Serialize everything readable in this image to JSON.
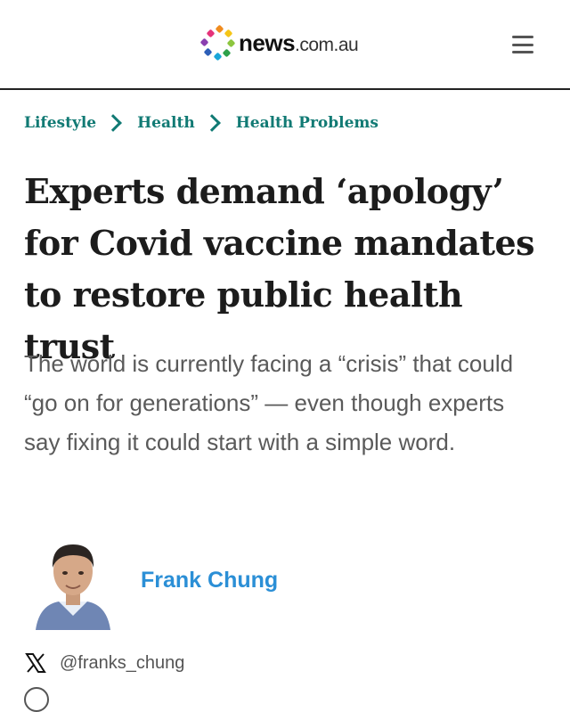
{
  "header": {
    "logo": {
      "brand": "news",
      "suffix": ".com.au"
    },
    "menu_icon": "hamburger-menu-icon"
  },
  "breadcrumb": [
    "Lifestyle",
    "Health",
    "Health Problems"
  ],
  "article": {
    "headline": "Experts demand ‘apology’ for Covid vaccine mandates to restore public health trust",
    "standfirst": "The world is currently facing a “crisis” that could “go on for generations” — even though experts say fixing it could start with a simple word."
  },
  "author": {
    "name": "Frank Chung",
    "twitter_handle": "@franks_chung",
    "social_icon": "x-icon"
  },
  "colors": {
    "breadcrumb": "#117a74",
    "author_link": "#2b8fd6",
    "headline": "#1c1c1c",
    "standfirst": "#5a5a5a"
  }
}
